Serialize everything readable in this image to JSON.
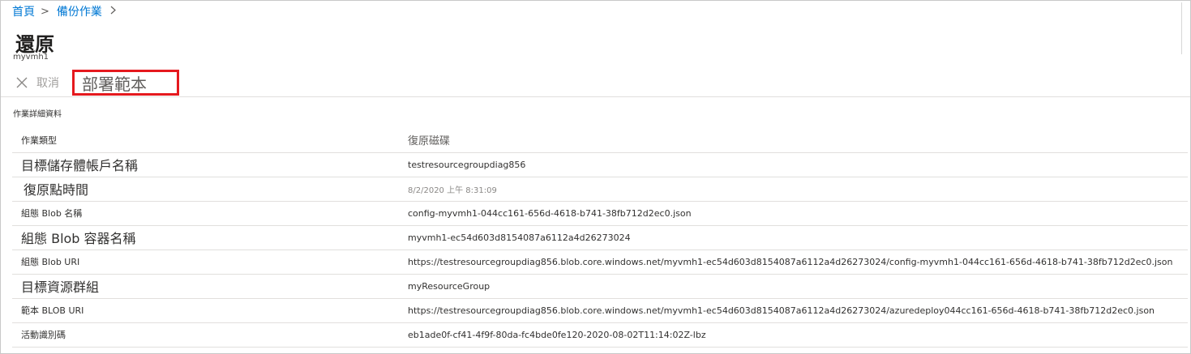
{
  "breadcrumb": {
    "items": [
      "首頁",
      "備份作業"
    ],
    "separator": ">"
  },
  "page": {
    "title": "還原",
    "subtitle": "myvmh1"
  },
  "toolbar": {
    "cancel_label": "取消",
    "deploy_label": "部署範本",
    "cancel_icon": "close-icon",
    "highlight_color": "#e5191e"
  },
  "details": {
    "section_label": "作業詳細資料",
    "rows": [
      {
        "label": "作業類型",
        "value": "復原磁碟"
      },
      {
        "label": "目標儲存體帳戶名稱",
        "value": "testresourcegroupdiag856"
      },
      {
        "label": "復原點時間",
        "value": "8/2/2020 上午 8:31:09"
      },
      {
        "label": "組態 Blob 名稱",
        "value": "config-myvmh1-044cc161-656d-4618-b741-38fb712d2ec0.json"
      },
      {
        "label": "組態 Blob 容器名稱",
        "value": "myvmh1-ec54d603d8154087a6112a4d26273024"
      },
      {
        "label": "組態 Blob URI",
        "value": "https://testresourcegroupdiag856.blob.core.windows.net/myvmh1-ec54d603d8154087a6112a4d26273024/config-myvmh1-044cc161-656d-4618-b741-38fb712d2ec0.json"
      },
      {
        "label": "目標資源群組",
        "value": "myResourceGroup"
      },
      {
        "label": "範本 BLOB URI",
        "value": "https://testresourcegroupdiag856.blob.core.windows.net/myvmh1-ec54d603d8154087a6112a4d26273024/azuredeploy044cc161-656d-4618-b741-38fb712d2ec0.json"
      },
      {
        "label": "活動識別碼",
        "value": "eb1ade0f-cf41-4f9f-80da-fc4bde0fe120-2020-08-02T11:14:02Z-lbz"
      }
    ]
  }
}
